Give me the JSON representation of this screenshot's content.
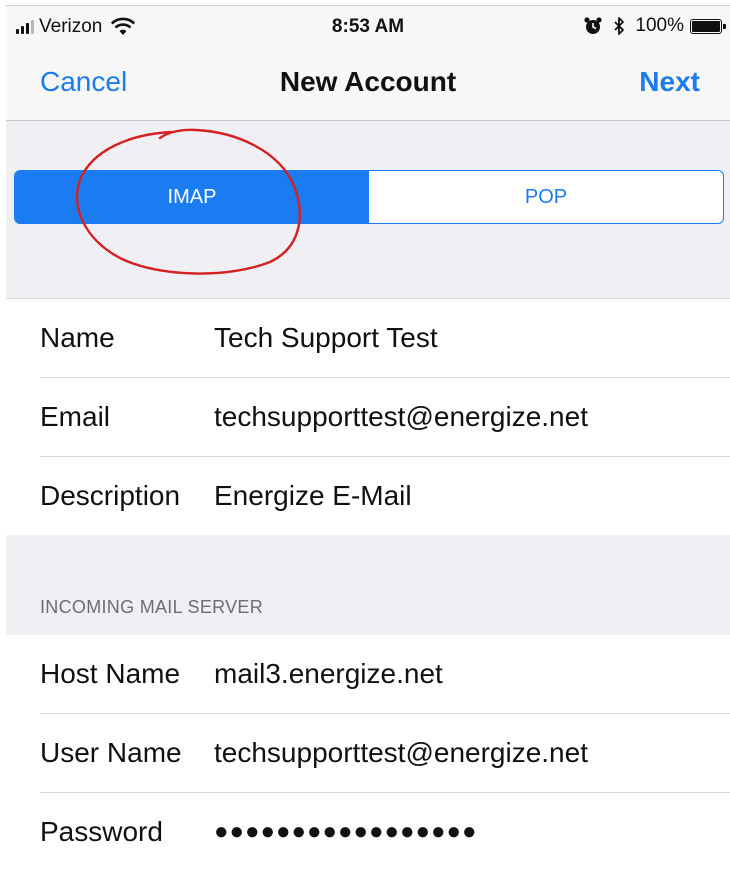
{
  "status_bar": {
    "carrier": "Verizon",
    "time": "8:53 AM",
    "battery": "100%",
    "icons": [
      "signal-icon",
      "wifi-icon",
      "alarm-icon",
      "bluetooth-icon",
      "battery-icon"
    ]
  },
  "navbar": {
    "cancel_label": "Cancel",
    "title": "New Account",
    "next_label": "Next"
  },
  "segmented": {
    "options": [
      {
        "label": "IMAP",
        "selected": true
      },
      {
        "label": "POP",
        "selected": false
      }
    ]
  },
  "account": {
    "name": {
      "label": "Name",
      "value": "Tech Support Test"
    },
    "email": {
      "label": "Email",
      "value": "techsupporttest@energize.net"
    },
    "description": {
      "label": "Description",
      "value": "Energize E-Mail"
    }
  },
  "incoming": {
    "header": "INCOMING MAIL SERVER",
    "host": {
      "label": "Host Name",
      "value": "mail3.energize.net"
    },
    "user": {
      "label": "User Name",
      "value": "techsupporttest@energize.net"
    },
    "password": {
      "label": "Password",
      "value": "●●●●●●●●●●●●●●●●●"
    }
  },
  "colors": {
    "accent": "#1a7cf0",
    "annotation": "#d42020",
    "group_background": "#efeff4"
  }
}
